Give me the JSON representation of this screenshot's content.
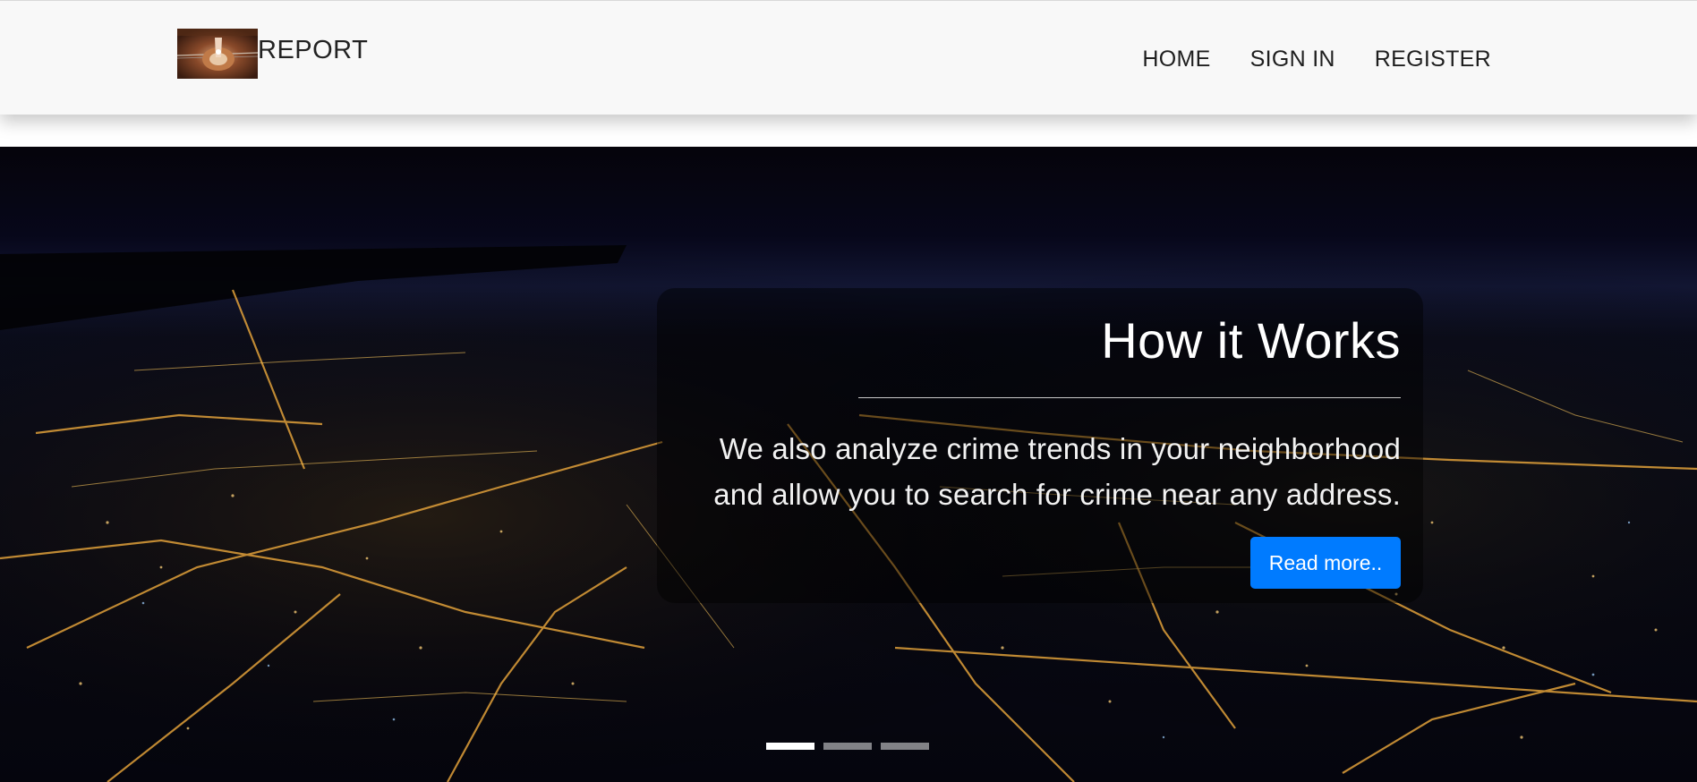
{
  "navbar": {
    "brand_text": "REPORT",
    "logo_icon": "report-logo-image",
    "links": [
      {
        "label": "HOME"
      },
      {
        "label": "SIGN IN"
      },
      {
        "label": "REGISTER"
      }
    ]
  },
  "carousel": {
    "background": "night-city-aerial-image",
    "slide": {
      "title": "How it Works",
      "text": "We also analyze crime trends in your neighborhood and allow you to search for crime near any address.",
      "button_label": "Read more.."
    },
    "indicators_count": 3,
    "active_indicator": 1
  },
  "colors": {
    "navbar_bg": "#f8f8f8",
    "button_bg": "#007bff",
    "hero_bg": "#04030a"
  }
}
